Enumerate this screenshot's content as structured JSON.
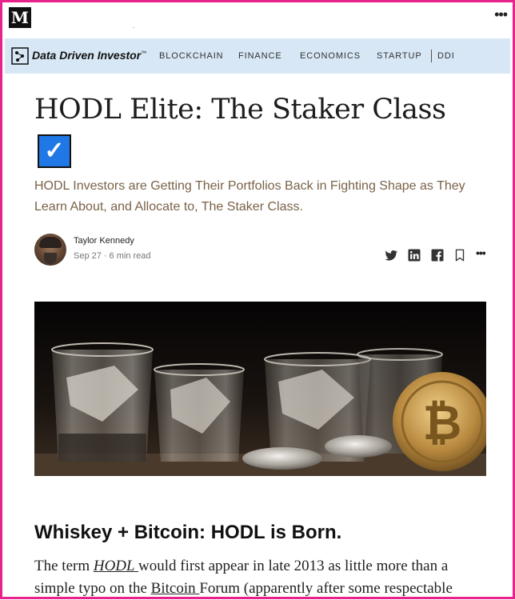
{
  "header": {
    "logo_letter": "M"
  },
  "publication": {
    "name": "Data Driven Investor",
    "trademark": "™",
    "nav": [
      "BLOCKCHAIN",
      "FINANCE",
      "ECONOMICS",
      "STARTUP",
      "DDI"
    ]
  },
  "article": {
    "title": "HODL Elite: The Staker Class",
    "checkbox_glyph": "✓",
    "subtitle": "HODL Investors are Getting Their Portfolios Back in Fighting Shape as They Learn About, and Allocate to, The Staker Class.",
    "author": "Taylor Kennedy",
    "date": "Sep 27",
    "separator": "·",
    "read_time": "6 min read",
    "share_icons": [
      "twitter-icon",
      "linkedin-icon",
      "facebook-icon",
      "bookmark-icon",
      "more-icon"
    ],
    "section_heading": "Whiskey + Bitcoin: HODL is Born.",
    "body": {
      "p1_a": "The term ",
      "p1_link_hodl": "HODL ",
      "p1_b": "would first appear in late 2013 as little more than a simple typo on the ",
      "p1_link_bitcoin": "Bitcoin ",
      "p1_c": "Forum (apparently after some respectable"
    }
  },
  "colors": {
    "frame": "#e8228c",
    "pub_bar": "#d7e7f5",
    "checkbox": "#1f78e6",
    "subtitle": "#7a6248"
  }
}
